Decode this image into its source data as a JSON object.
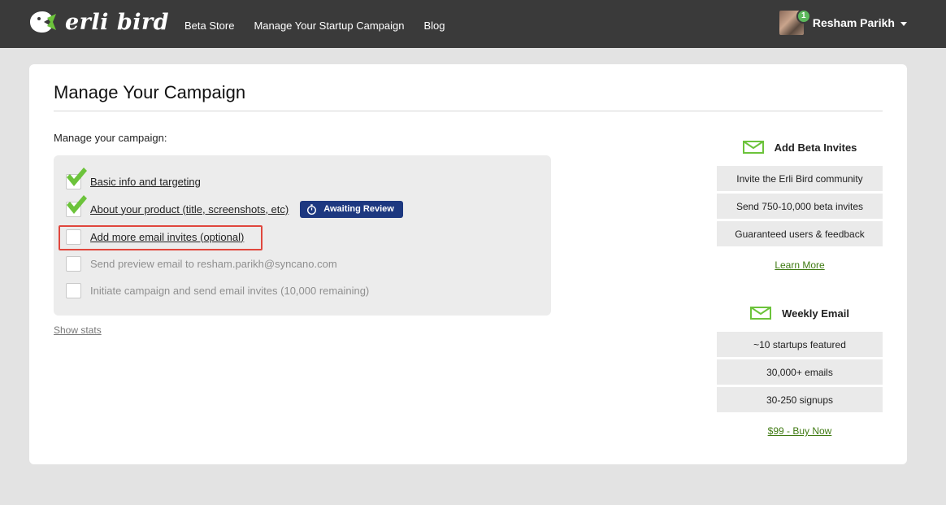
{
  "brand": {
    "name": "erli bird"
  },
  "nav": {
    "items": [
      "Beta Store",
      "Manage Your Startup Campaign",
      "Blog"
    ]
  },
  "user": {
    "name": "Resham Parikh",
    "notification_count": "1"
  },
  "page": {
    "title": "Manage Your Campaign",
    "section_label": "Manage your campaign:"
  },
  "steps": [
    {
      "label": "Basic info and targeting",
      "done": true
    },
    {
      "label": "About your product (title, screenshots, etc)",
      "done": true,
      "badge": "Awaiting Review"
    },
    {
      "label": "Add more email invites (optional)",
      "done": false
    },
    {
      "label": "Send preview email to resham.parikh@syncano.com",
      "done": false
    },
    {
      "label": "Initiate campaign and send email invites (10,000 remaining)",
      "done": false
    }
  ],
  "show_stats": "Show stats",
  "sidebar": {
    "beta_invites": {
      "title": "Add Beta Invites",
      "items": [
        "Invite the Erli Bird community",
        "Send 750-10,000 beta invites",
        "Guaranteed users & feedback"
      ],
      "link": "Learn More"
    },
    "weekly_email": {
      "title": "Weekly Email",
      "items": [
        "~10 startups featured",
        "30,000+ emails",
        "30-250 signups"
      ],
      "link": "$99 - Buy Now"
    }
  },
  "colors": {
    "topbar": "#3a3a3a",
    "accent_green": "#6cc33b",
    "badge_blue": "#1d3880",
    "highlight_red": "#e0473d"
  }
}
